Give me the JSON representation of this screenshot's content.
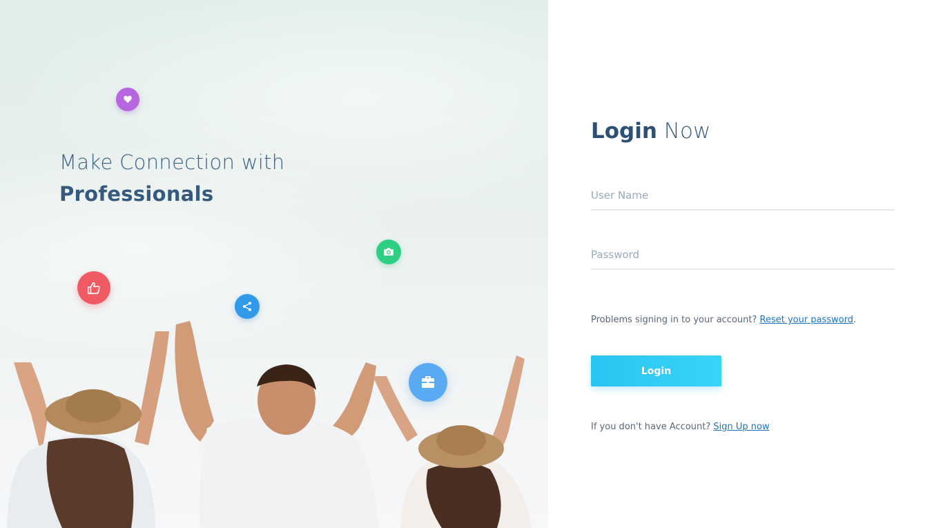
{
  "hero": {
    "title_line1": "Make Connection with",
    "title_line2": "Professionals",
    "icons": [
      "heart-icon",
      "thumbs-up-icon",
      "share-icon",
      "camera-icon",
      "briefcase-icon"
    ],
    "colors": {
      "heart": "#b865e0",
      "like": "#ef5a63",
      "share": "#3199ea",
      "camera": "#2fcf83",
      "briefcase": "#5aaaf3"
    }
  },
  "login": {
    "title_bold": "Login",
    "title_light": "Now",
    "username_placeholder": "User Name",
    "password_placeholder": "Password",
    "help_text": "Problems signing in to your account?",
    "reset_link": "Reset your password",
    "help_suffix": ".",
    "button_label": "Login",
    "signup_text": "If you don't have Account?",
    "signup_link": "Sign Up now"
  }
}
